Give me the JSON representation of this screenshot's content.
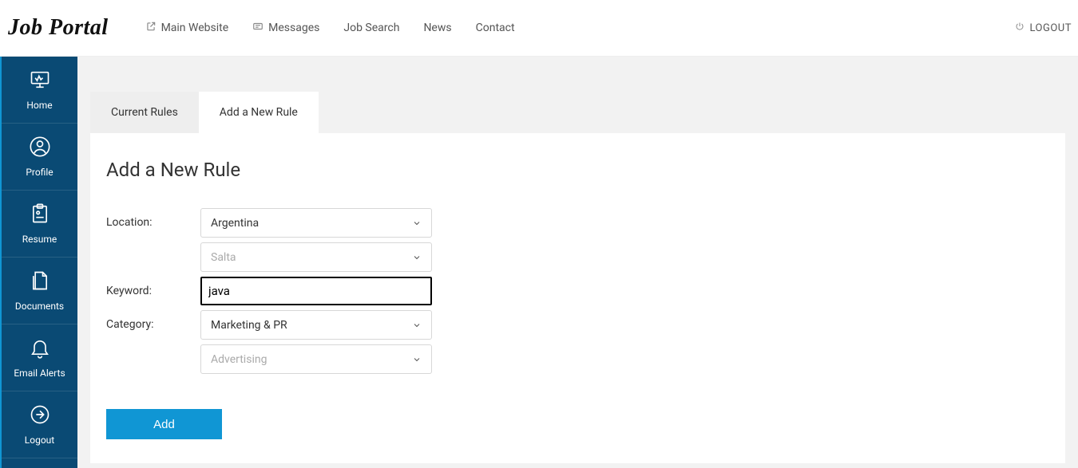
{
  "brand": "Job Portal",
  "topnav": {
    "main_website": "Main Website",
    "messages": "Messages",
    "job_search": "Job Search",
    "news": "News",
    "contact": "Contact"
  },
  "logout_top": "LOGOUT",
  "sidebar": {
    "home": "Home",
    "profile": "Profile",
    "resume": "Resume",
    "documents": "Documents",
    "email_alerts": "Email Alerts",
    "logout": "Logout"
  },
  "tabs": {
    "current": "Current Rules",
    "addnew": "Add a New Rule"
  },
  "page": {
    "title": "Add a New Rule",
    "labels": {
      "location": "Location:",
      "keyword": "Keyword:",
      "category": "Category:"
    },
    "values": {
      "country": "Argentina",
      "region": "Salta",
      "keyword": "java",
      "category": "Marketing & PR",
      "subcategory": "Advertising"
    },
    "button": "Add"
  }
}
